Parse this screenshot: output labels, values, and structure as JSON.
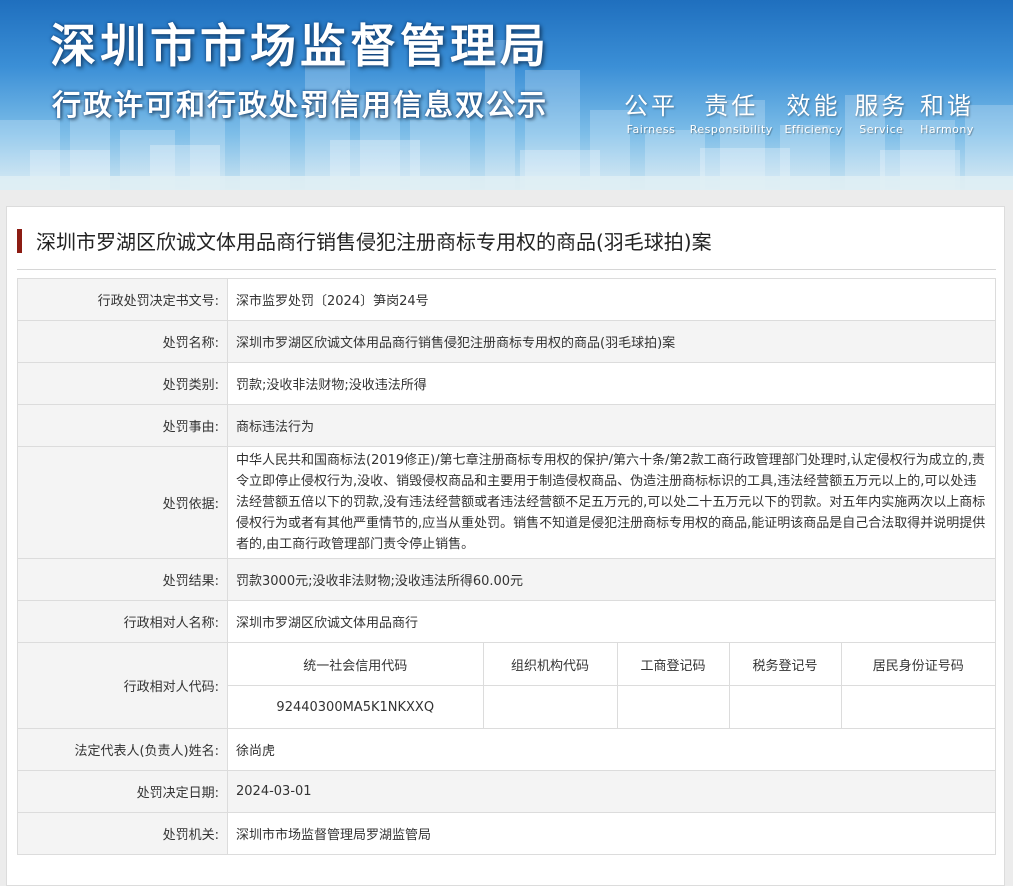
{
  "banner": {
    "title": "深圳市市场监督管理局",
    "subtitle": "行政许可和行政处罚信用信息双公示",
    "values": [
      {
        "cn": "公平",
        "en": "Fairness"
      },
      {
        "cn": "责任",
        "en": "Responsibility"
      },
      {
        "cn": "效能",
        "en": "Efficiency"
      },
      {
        "cn": "服务",
        "en": "Service"
      },
      {
        "cn": "和谐",
        "en": "Harmony"
      }
    ]
  },
  "case": {
    "title": "深圳市罗湖区欣诚文体用品商行销售侵犯注册商标专用权的商品(羽毛球拍)案"
  },
  "rows": {
    "decision_no": {
      "label": "行政处罚决定书文号:",
      "value": "深市监罗处罚〔2024〕笋岗24号"
    },
    "name": {
      "label": "处罚名称:",
      "value": "深圳市罗湖区欣诚文体用品商行销售侵犯注册商标专用权的商品(羽毛球拍)案"
    },
    "category": {
      "label": "处罚类别:",
      "value": "罚款;没收非法财物;没收违法所得"
    },
    "reason": {
      "label": "处罚事由:",
      "value": "商标违法行为"
    },
    "basis": {
      "label": "处罚依据:",
      "value": "中华人民共和国商标法(2019修正)/第七章注册商标专用权的保护/第六十条/第2款工商行政管理部门处理时,认定侵权行为成立的,责令立即停止侵权行为,没收、销毁侵权商品和主要用于制造侵权商品、伪造注册商标标识的工具,违法经营额五万元以上的,可以处违法经营额五倍以下的罚款,没有违法经营额或者违法经营额不足五万元的,可以处二十五万元以下的罚款。对五年内实施两次以上商标侵权行为或者有其他严重情节的,应当从重处罚。销售不知道是侵犯注册商标专用权的商品,能证明该商品是自己合法取得并说明提供者的,由工商行政管理部门责令停止销售。"
    },
    "result": {
      "label": "处罚结果:",
      "value": "罚款3000元;没收非法财物;没收违法所得60.00元"
    },
    "party_name": {
      "label": "行政相对人名称:",
      "value": "深圳市罗湖区欣诚文体用品商行"
    },
    "party_code": {
      "label": "行政相对人代码:",
      "headers": [
        "统一社会信用代码",
        "组织机构代码",
        "工商登记码",
        "税务登记号",
        "居民身份证号码"
      ],
      "values": [
        "92440300MA5K1NKXXQ",
        "",
        "",
        "",
        ""
      ]
    },
    "legal_rep": {
      "label": "法定代表人(负责人)姓名:",
      "value": "徐尚虎"
    },
    "decision_date": {
      "label": "处罚决定日期:",
      "value": "2024-03-01"
    },
    "authority": {
      "label": "处罚机关:",
      "value": "深圳市市场监督管理局罗湖监管局"
    }
  }
}
